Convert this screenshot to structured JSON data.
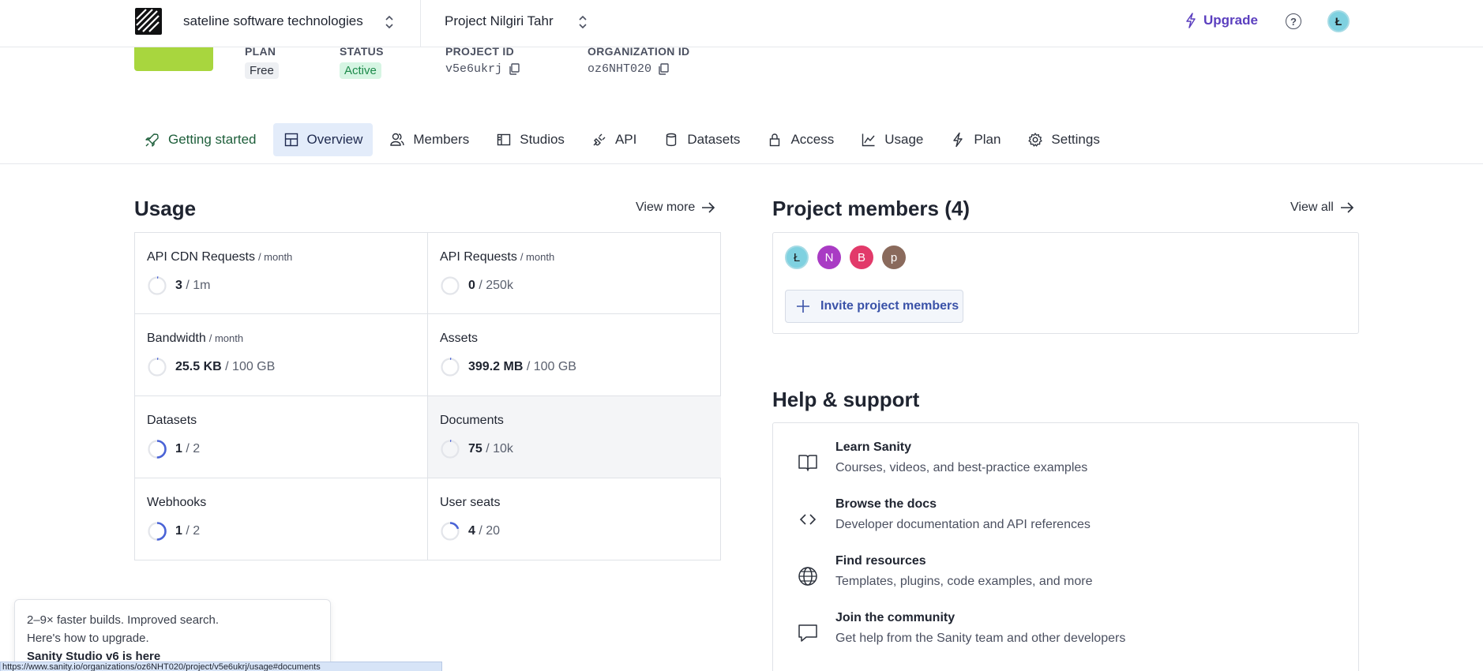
{
  "header": {
    "org_name": "sateline software technologies",
    "project_name": "Project Nilgiri Tahr",
    "upgrade_label": "Upgrade",
    "help_label": "?",
    "avatar_letter": "Ł"
  },
  "project": {
    "plan_label": "PLAN",
    "plan_value": "Free",
    "status_label": "STATUS",
    "status_value": "Active",
    "project_id_label": "PROJECT ID",
    "project_id_value": "v5e6ukrj",
    "org_id_label": "ORGANIZATION ID",
    "org_id_value": "oz6NHT020"
  },
  "tabs": [
    {
      "label": "Getting started",
      "icon": "rocket-icon"
    },
    {
      "label": "Overview",
      "icon": "dashboard-icon"
    },
    {
      "label": "Members",
      "icon": "users-icon"
    },
    {
      "label": "Studios",
      "icon": "studio-icon"
    },
    {
      "label": "API",
      "icon": "plug-icon"
    },
    {
      "label": "Datasets",
      "icon": "database-icon"
    },
    {
      "label": "Access",
      "icon": "lock-icon"
    },
    {
      "label": "Usage",
      "icon": "chart-icon"
    },
    {
      "label": "Plan",
      "icon": "bolt-icon"
    },
    {
      "label": "Settings",
      "icon": "gear-icon"
    }
  ],
  "usage": {
    "title": "Usage",
    "view_more": "View more",
    "cells": [
      {
        "title": "API CDN Requests",
        "sub": "/ month",
        "value": "3",
        "limit": " / 1m",
        "fraction": 0.01
      },
      {
        "title": "API Requests",
        "sub": "/ month",
        "value": "0",
        "limit": " / 250k",
        "fraction": 0.0
      },
      {
        "title": "Bandwidth",
        "sub": "/ month",
        "value": "25.5 KB",
        "limit": " / 100 GB",
        "fraction": 0.01
      },
      {
        "title": "Assets",
        "sub": "",
        "value": "399.2 MB",
        "limit": " / 100 GB",
        "fraction": 0.01
      },
      {
        "title": "Datasets",
        "sub": "",
        "value": "1",
        "limit": " / 2",
        "fraction": 0.5
      },
      {
        "title": "Documents",
        "sub": "",
        "value": "75",
        "limit": " / 10k",
        "fraction": 0.01
      },
      {
        "title": "Webhooks",
        "sub": "",
        "value": "1",
        "limit": " / 2",
        "fraction": 0.5
      },
      {
        "title": "User seats",
        "sub": "",
        "value": "4",
        "limit": " / 20",
        "fraction": 0.2
      }
    ]
  },
  "members": {
    "title": "Project members (4)",
    "view_all": "View all",
    "avatars": [
      {
        "letter": "Ł",
        "color": "#7fd1e0"
      },
      {
        "letter": "N",
        "color": "#a93bc4"
      },
      {
        "letter": "B",
        "color": "#e23a6a"
      },
      {
        "letter": "p",
        "color": "#8a6a5c"
      }
    ],
    "invite_label": "Invite project members"
  },
  "help": {
    "title": "Help & support",
    "items": [
      {
        "title": "Learn Sanity",
        "desc": "Courses, videos, and best-practice examples",
        "icon": "book-icon"
      },
      {
        "title": "Browse the docs",
        "desc": "Developer documentation and API references",
        "icon": "code-icon"
      },
      {
        "title": "Find resources",
        "desc": "Templates, plugins, code examples, and more",
        "icon": "globe-icon"
      },
      {
        "title": "Join the community",
        "desc": "Get help from the Sanity team and other developers",
        "icon": "chat-icon"
      }
    ]
  },
  "toast": {
    "line1": "2–9× faster builds. Improved search.",
    "line2": "Here's how to upgrade.",
    "title": "Sanity Studio v6 is here"
  },
  "statusbar": {
    "url": "https://www.sanity.io/organizations/oz6NHT020/project/v5e6ukrj/usage#documents"
  },
  "colors": {
    "accent": "#5b3fbf",
    "ring_fill": "#4a63d6",
    "ring_track": "#e3e5ea",
    "plan_green": "#a8d63e"
  }
}
